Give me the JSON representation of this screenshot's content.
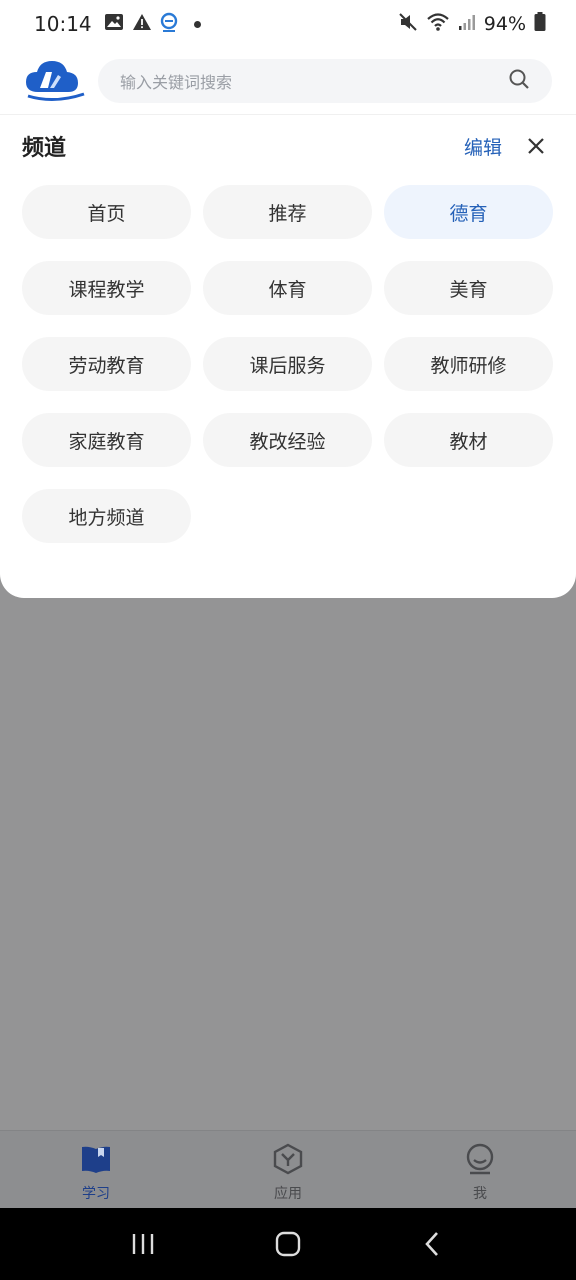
{
  "status_bar": {
    "time": "10:14",
    "battery": "94%"
  },
  "header": {
    "search": {
      "placeholder": "输入关键词搜索"
    }
  },
  "channel_panel": {
    "title": "频道",
    "edit_label": "编辑",
    "channels": [
      {
        "label": "首页",
        "active": false
      },
      {
        "label": "推荐",
        "active": false
      },
      {
        "label": "德育",
        "active": true
      },
      {
        "label": "课程教学",
        "active": false
      },
      {
        "label": "体育",
        "active": false
      },
      {
        "label": "美育",
        "active": false
      },
      {
        "label": "劳动教育",
        "active": false
      },
      {
        "label": "课后服务",
        "active": false
      },
      {
        "label": "教师研修",
        "active": false
      },
      {
        "label": "家庭教育",
        "active": false
      },
      {
        "label": "教改经验",
        "active": false
      },
      {
        "label": "教材",
        "active": false
      },
      {
        "label": "地方频道",
        "active": false
      }
    ]
  },
  "tab_bar": {
    "tabs": [
      {
        "label": "学习",
        "icon": "book-icon",
        "active": true
      },
      {
        "label": "应用",
        "icon": "apps-hexagon-icon",
        "active": false
      },
      {
        "label": "我",
        "icon": "profile-icon",
        "active": false
      }
    ]
  },
  "colors": {
    "accent": "#2561b8",
    "active_chip_bg": "#eef4fd",
    "chip_bg": "#f5f5f5",
    "overlay": "#949495"
  }
}
